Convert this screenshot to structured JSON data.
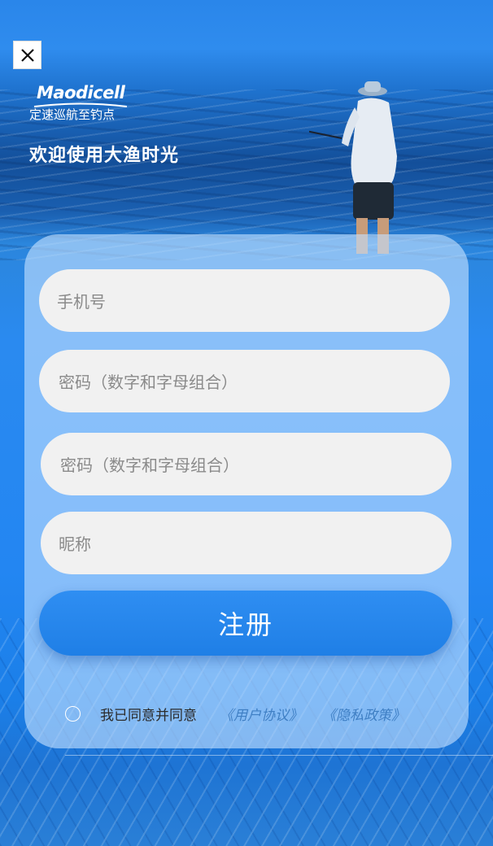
{
  "header": {
    "brand": "Maodicell",
    "brand_slogan": "定速巡航至钓点",
    "welcome": "欢迎使用大渔时光"
  },
  "form": {
    "phone_placeholder": "手机号",
    "password_placeholder": "密码（数字和字母组合）",
    "confirm_password_placeholder": "密码（数字和字母组合）",
    "nickname_placeholder": "昵称",
    "register_label": "注册"
  },
  "agreement": {
    "prefix": "我已同意并同意",
    "user_agreement": "《用户协议》",
    "privacy_policy": "《隐私政策》",
    "checked": false
  },
  "icons": {
    "close": "close-icon",
    "checkbox": "radio-circle-icon"
  },
  "colors": {
    "primary": "#1f7fe6",
    "field_bg": "#f1f1f1",
    "link": "#3f7fc4"
  }
}
